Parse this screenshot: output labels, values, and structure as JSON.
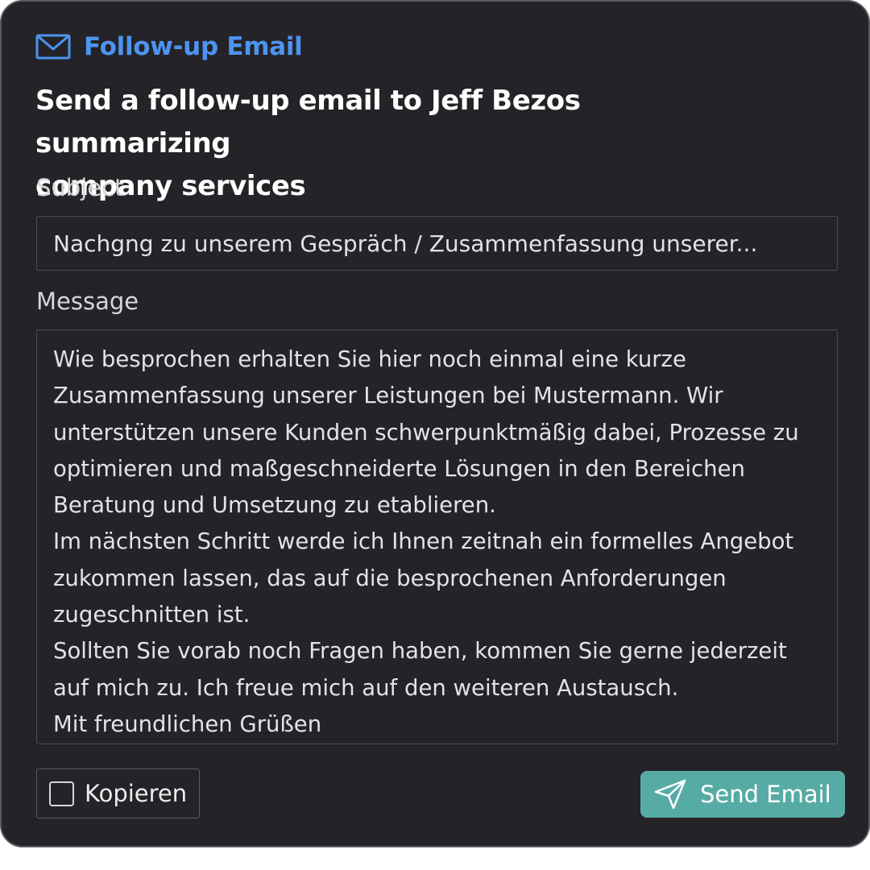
{
  "header": {
    "icon": "mail-icon",
    "title": "Follow-up Email",
    "accent_color": "#4d94f0"
  },
  "task": {
    "title_line1": "Send a follow-up email to Jeff Bezos summarizing",
    "title_line2": "company services"
  },
  "form": {
    "subject_label": "Subject",
    "subject_value": "Nachgng zu unserem Gespräch / Zusammenfassung unserer...",
    "message_label": "Message",
    "message_lines": [
      "Wie besprochen erhalten Sie hier noch einmal eine kurze",
      "Zusammenfassung unserer Leistungen bei Mustermann. Wir",
      "unterstützen unsere Kunden schwerpunktmäßig dabei, Prozesse zu",
      "optimieren und maßgeschneiderte Lösungen in den Bereichen",
      "Beratung und Umsetzung zu etablieren.",
      "Im nächsten Schritt werde ich Ihnen zeitnah ein formelles Angebot",
      "zukommen lassen, das auf die besprochenen Anforderungen",
      "zugeschnitten ist.",
      "Sollten Sie vorab noch Fragen haben, kommen Sie gerne jederzeit",
      "auf mich zu. Ich freue mich auf den weiteren Austausch.",
      "Mit freundlichen Grüßen"
    ]
  },
  "footer": {
    "copy_label": "Kopieren",
    "copy_checked": false,
    "send_label": "Send Email",
    "send_icon": "send-icon",
    "send_color": "#56aca5"
  }
}
